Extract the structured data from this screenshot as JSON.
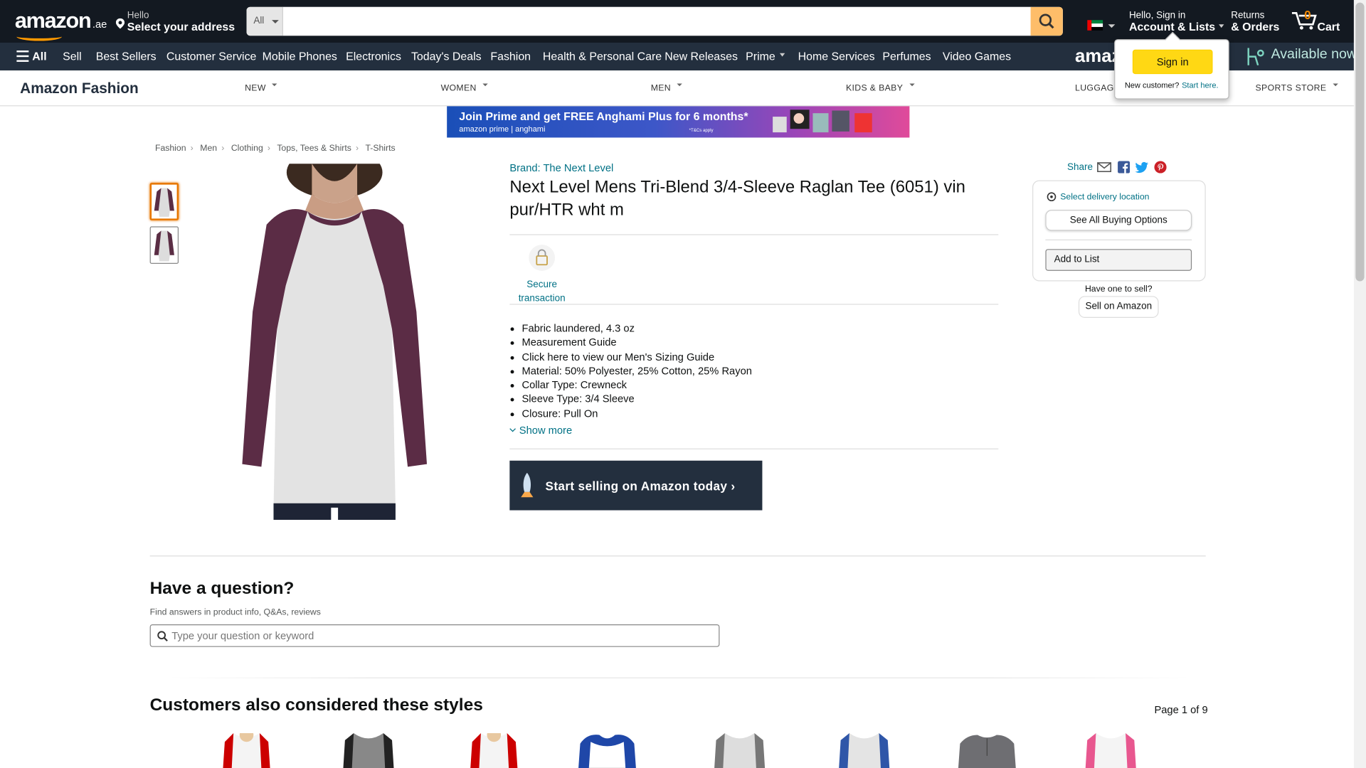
{
  "header": {
    "logo_text": "amazon",
    "logo_tld": ".ae",
    "deliver_hello": "Hello",
    "deliver_address": "Select your address",
    "search_category": "All",
    "search_placeholder": "",
    "account_hello": "Hello, Sign in",
    "account_label": "Account & Lists",
    "returns_line1": "Returns",
    "returns_line2": "& Orders",
    "cart_count": "0",
    "cart_label": "Cart"
  },
  "subnav": {
    "all_label": "All",
    "items": [
      "Sell",
      "Best Sellers",
      "Customer Service",
      "Mobile Phones",
      "Electronics",
      "Today's Deals",
      "Fashion",
      "Health & Personal Care",
      "New Releases",
      "Prime",
      "Home Services",
      "Perfumes",
      "Video Games"
    ],
    "promo_text": "Available now"
  },
  "signin_popover": {
    "button": "Sign in",
    "new_customer": "New customer?",
    "start_here": "Start here."
  },
  "fashion_nav": {
    "title": "Amazon Fashion",
    "items": [
      "NEW",
      "WOMEN",
      "MEN",
      "KIDS & BABY",
      "LUGGAGE",
      "SPORTS STORE"
    ]
  },
  "banner": {
    "headline": "Join Prime and get FREE Anghami Plus for 6 months*",
    "brands": "amazon prime  |  anghami",
    "terms": "*T&Cs apply"
  },
  "breadcrumb": [
    "Fashion",
    "Men",
    "Clothing",
    "Tops, Tees & Shirts",
    "T-Shirts"
  ],
  "product": {
    "brand": "Brand: The Next Level",
    "title": "Next Level Mens Tri-Blend 3/4-Sleeve Raglan Tee (6051) vin pur/HTR wht m",
    "secure_label": "Secure transaction",
    "bullets": [
      "Fabric laundered, 4.3 oz",
      "Measurement Guide",
      "Click here to view our Men's Sizing Guide",
      "Material: 50% Polyester, 25% Cotton, 25% Rayon",
      "Collar Type: Crewneck",
      "Sleeve Type: 3/4 Sleeve",
      "Closure: Pull On"
    ],
    "show_more": "Show more",
    "sell_banner": "Start selling on Amazon today ›"
  },
  "buybox": {
    "share": "Share",
    "delivery_link": "Select delivery location",
    "see_options": "See All Buying Options",
    "add_to_list": "Add to List",
    "have_one": "Have one to sell?",
    "sell_on_amazon": "Sell on Amazon"
  },
  "questions": {
    "title": "Have a question?",
    "subtitle": "Find answers in product info, Q&As, reviews",
    "placeholder": "Type your question or keyword"
  },
  "similar": {
    "title": "Customers also considered these styles",
    "page": "Page 1 of 9"
  },
  "colors": {
    "nav_dark": "#131921",
    "nav_sub": "#232F3E",
    "search_button": "#FEBD69",
    "link": "#007185",
    "accent_orange": "#FF9900",
    "signin_yellow": "#FFD814"
  }
}
